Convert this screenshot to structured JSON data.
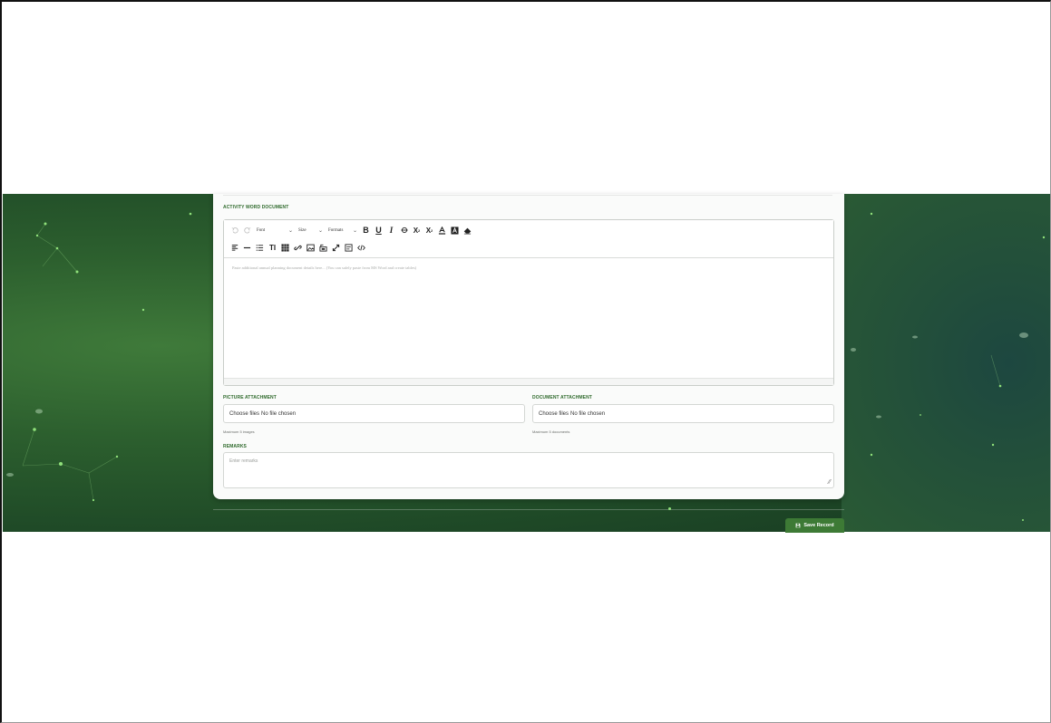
{
  "form": {
    "activity_label": "ACTIVITY WORD DOCUMENT",
    "picture_label": "PICTURE ATTACHMENT",
    "document_label": "DOCUMENT ATTACHMENT",
    "remarks_label": "REMARKS"
  },
  "editor": {
    "toolbar": {
      "font_select": "Font",
      "size_select": "Size",
      "formats_select": "Formats",
      "row1_icons": [
        "undo-icon",
        "redo-icon",
        "bold-icon",
        "underline-icon",
        "italic-icon",
        "strikethrough-icon",
        "subscript-icon",
        "superscript-icon",
        "font-color-icon",
        "highlight-color-icon",
        "eraser-icon"
      ],
      "row2_icons": [
        "align-icon",
        "horizontal-rule-icon",
        "list-icon",
        "line-height-icon",
        "table-icon",
        "link-icon",
        "image-icon",
        "video-icon",
        "fullscreen-icon",
        "show-blocks-icon",
        "code-view-icon"
      ]
    },
    "placeholder": "Paste additional annual planning document details here... (You can safely paste from MS Word and create tables)"
  },
  "picture_attachment": {
    "button_text": "Choose files",
    "status_text": "No file chosen",
    "hint": "Maximum 5 images"
  },
  "document_attachment": {
    "button_text": "Choose files",
    "status_text": "No file chosen",
    "hint": "Maximum 5 documents"
  },
  "remarks": {
    "placeholder": "Enter remarks"
  },
  "actions": {
    "save_label": "Save Record",
    "save_icon": "floppy-disk-icon"
  },
  "colors": {
    "accent": "#2f6a2c",
    "button": "#3d7a35",
    "background_dark": "#1f4a27"
  }
}
